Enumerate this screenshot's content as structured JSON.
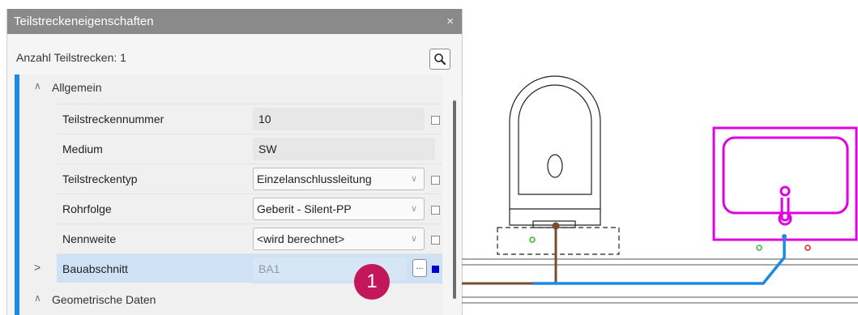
{
  "window": {
    "title": "Teilstreckeneigenschaften",
    "close_glyph": "×"
  },
  "count_label": "Anzahl Teilstrecken: 1",
  "categories": {
    "general": {
      "label": "Allgemein",
      "chevron": "∧"
    },
    "geometry": {
      "label": "Geometrische Daten",
      "chevron": "∧"
    }
  },
  "rows": [
    {
      "name": "Teilstreckennummer",
      "value": "10",
      "kind": "text"
    },
    {
      "name": "Medium",
      "value": "SW",
      "kind": "text"
    },
    {
      "name": "Teilstreckentyp",
      "value": "Einzelanschlussleitung",
      "kind": "combo"
    },
    {
      "name": "Rohrfolge",
      "value": "Geberit - Silent-PP",
      "kind": "combo"
    },
    {
      "name": "Nennweite",
      "value": "<wird berechnet>",
      "kind": "combo"
    },
    {
      "name": "Bauabschnitt",
      "value": "BA1",
      "kind": "picker",
      "expander": ">",
      "dots": "..."
    }
  ],
  "badge": "1",
  "icons": {
    "search": "search-icon",
    "dropdown": "chevron-down-icon",
    "close": "close-icon"
  },
  "colors": {
    "accent": "#1e88e5",
    "selection": "#cfe2f5",
    "badge": "#c2185b",
    "pipe_blue": "#1e88e5",
    "pipe_brown": "#7a4e2d",
    "fixture_highlight": "#e000e0",
    "marker_green": "#3bb33b",
    "marker_red": "#e02020"
  }
}
